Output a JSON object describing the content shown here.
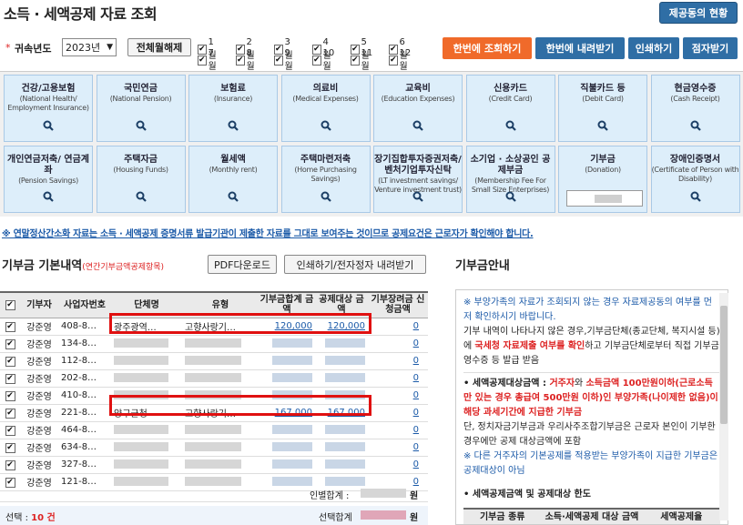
{
  "header": {
    "title": "소득 · 세액공제 자료 조회",
    "history_button": "제공동의 현황"
  },
  "filter": {
    "year_label": "귀속년도",
    "year_value": "2023년",
    "toggle_all": "전체월해제",
    "months": [
      "1월",
      "2월",
      "3월",
      "4월",
      "5월",
      "6월",
      "7월",
      "8월",
      "9월",
      "10월",
      "11월",
      "12월"
    ]
  },
  "actions": {
    "query_all": "한번에 조회하기",
    "download_all": "한번에 내려받기",
    "print": "인쇄하기",
    "receive": "점자받기"
  },
  "tiles_row1": [
    {
      "name": "건강/고용보험",
      "en": "(National Health/ Employment Insurance)"
    },
    {
      "name": "국민연금",
      "en": "(National Pension)"
    },
    {
      "name": "보험료",
      "en": "(Insurance)"
    },
    {
      "name": "의료비",
      "en": "(Medical Expenses)"
    },
    {
      "name": "교육비",
      "en": "(Education Expenses)"
    },
    {
      "name": "신용카드",
      "en": "(Credit Card)"
    },
    {
      "name": "직불카드 등",
      "en": "(Debit Card)"
    },
    {
      "name": "현금영수증",
      "en": "(Cash Receipt)"
    }
  ],
  "tiles_row2": [
    {
      "name": "개인연금저축/ 연금계좌",
      "en": "(Pension Savings)"
    },
    {
      "name": "주택자금",
      "en": "(Housing Funds)"
    },
    {
      "name": "월세액",
      "en": "(Monthly rent)"
    },
    {
      "name": "주택마련저축",
      "en": "(Home Purchasing Savings)"
    },
    {
      "name": "장기집합투자증권저축/ 벤처기업투자신탁",
      "en": "(LT investment savings/ Venture investment trust)"
    },
    {
      "name": "소기업 · 소상공인 공제부금",
      "en": "(Membership Fee For Small Size Enterprises)"
    },
    {
      "name": "기부금",
      "en": "(Donation)"
    },
    {
      "name": "장애인증명서",
      "en": "(Certificate of Person with Disability)"
    }
  ],
  "notice": "※ 연말정산간소화 자료는 소득 · 세액공제 증명서류 발급기관이 제출한 자료를 그대로 보여주는 것이므로 공제요건은 근로자가 확인해야 합니다.",
  "donation": {
    "title": "기부금 기본내역",
    "subtitle": "(연간기부금액공제항목)",
    "pdf_button": "PDF다운로드",
    "print_button": "인쇄하기/전자정자 내려받기",
    "columns": [
      "기부자",
      "사업자번호",
      "단체명",
      "유형",
      "기부금합계 금액",
      "공제대상 금액",
      "기부장려금 신청금액"
    ],
    "rows": [
      {
        "donor": "강준영",
        "bizno": "408-8…",
        "org": "광주광역…",
        "type": "고향사랑기…",
        "total": "120,000",
        "deductible": "120,000",
        "incentive": "0"
      },
      {
        "donor": "강준영",
        "bizno": "134-8…",
        "org": "",
        "type": "",
        "total": "",
        "deductible": "",
        "incentive": "0"
      },
      {
        "donor": "강준영",
        "bizno": "112-8…",
        "org": "",
        "type": "",
        "total": "",
        "deductible": "",
        "incentive": "0"
      },
      {
        "donor": "강준영",
        "bizno": "202-8…",
        "org": "",
        "type": "",
        "total": "",
        "deductible": "",
        "incentive": "0"
      },
      {
        "donor": "강준영",
        "bizno": "410-8…",
        "org": "",
        "type": "",
        "total": "",
        "deductible": "",
        "incentive": "0"
      },
      {
        "donor": "강준영",
        "bizno": "221-8…",
        "org": "양구군청",
        "type": "고향사랑기…",
        "total": "167,000",
        "deductible": "167,000",
        "incentive": "0"
      },
      {
        "donor": "강준영",
        "bizno": "464-8…",
        "org": "",
        "type": "",
        "total": "",
        "deductible": "",
        "incentive": "0"
      },
      {
        "donor": "강준영",
        "bizno": "634-8…",
        "org": "",
        "type": "",
        "total": "",
        "deductible": "",
        "incentive": "0"
      },
      {
        "donor": "강준영",
        "bizno": "327-8…",
        "org": "",
        "type": "",
        "total": "",
        "deductible": "",
        "incentive": "0"
      },
      {
        "donor": "강준영",
        "bizno": "121-8…",
        "org": "",
        "type": "",
        "total": "",
        "deductible": "",
        "incentive": "0"
      }
    ],
    "sum_label": "인별합계 :",
    "sum_unit": "원",
    "selected_label": "선택 : ",
    "selected_count": "10 건",
    "selected_sum_label": "선택합계",
    "selected_sum_unit": "원"
  },
  "guide": {
    "title": "기부금안내",
    "p1": "※ 부양가족의 자료가 조회되지 않는 경우 자료제공동의 여부를 먼저 확인하시기 바랍니다.",
    "p2a": "기부 내역이 나타나지 않은 경우,기부금단체(종교단체, 복지시설 등)에 ",
    "p2b": "국세청 자료제출 여부를 확인",
    "p2c": "하고 기부금단체로부터 직접 기부금영수증 등 발급 받음",
    "p3a": "• 세액공제대상금액 : ",
    "p3b": "거주자",
    "p3c": "와 ",
    "p3d": "소득금액 100만원이하(근로소득만 있는 경우 총급여 500만원 이하)인 부양가족(나이제한 없음)이 해당 과세기간에 지급한 기부금",
    "p4": "단, 정치자금기부금과 우리사주조합기부금은 근로자 본인이 기부한 경우에만 공제 대상금액에 포함",
    "p5": "※ 다른 거주자의 기본공제를 적용받는 부양가족이 지급한 기부금은 공제대상이 아님",
    "p6": "• 세액공제금액 및 공제대상 한도",
    "table_head1": "기부금 종류",
    "table_head2": "소득·세액공제 대상 금액",
    "table_head3": "세액공제율"
  }
}
